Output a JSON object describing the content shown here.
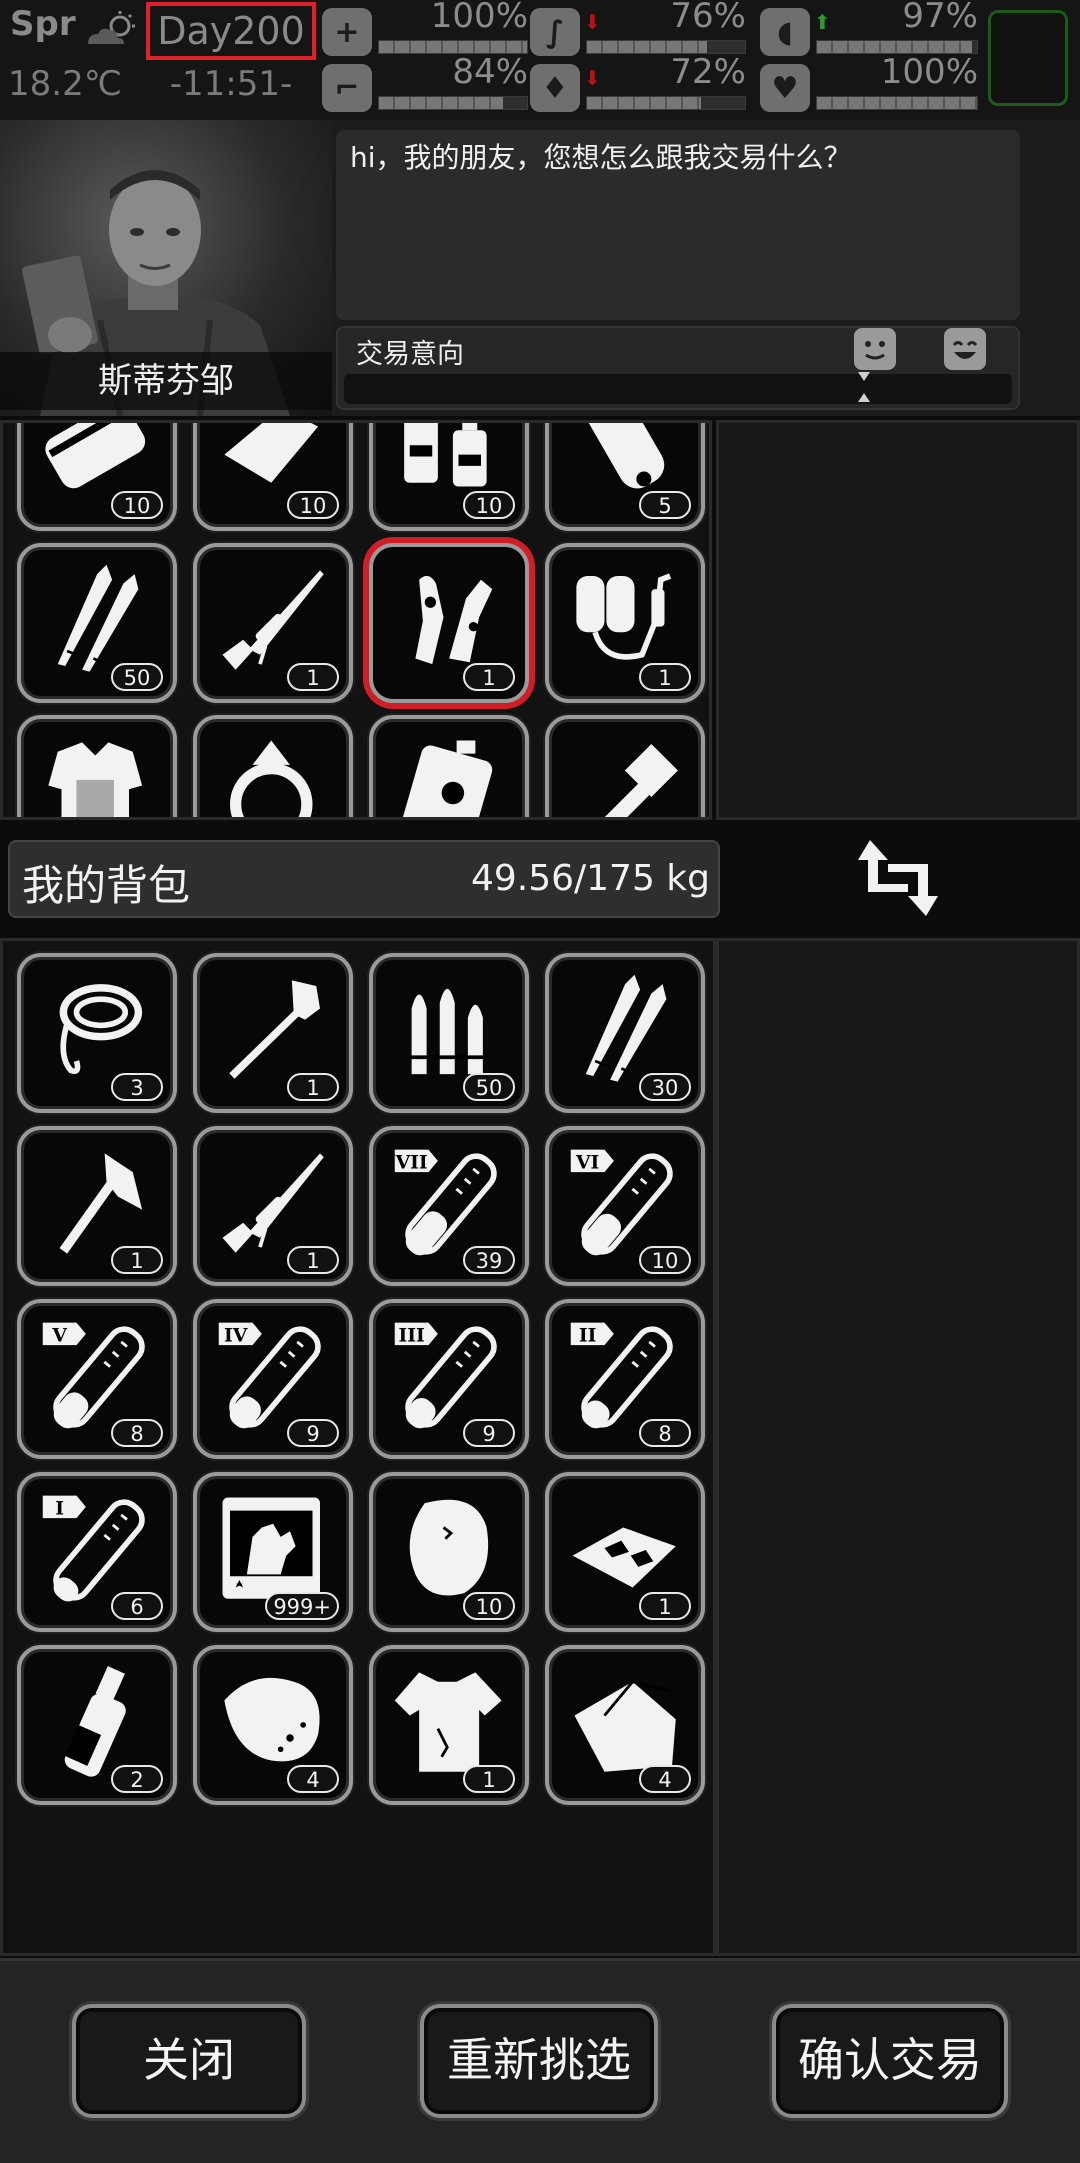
{
  "status": {
    "season": "Spr",
    "temperature": "18.2℃",
    "day": "Day200",
    "time": "-11:51-",
    "stats": [
      {
        "name": "health",
        "icon": "medkit-icon",
        "percent": "100%",
        "level": 1.0,
        "trend": ""
      },
      {
        "name": "hunger",
        "icon": "stomach-icon",
        "percent": "76%",
        "level": 0.76,
        "trend": "down"
      },
      {
        "name": "mood",
        "icon": "pill-icon",
        "percent": "97%",
        "level": 0.97,
        "trend": "up"
      },
      {
        "name": "stamina",
        "icon": "boot-icon",
        "percent": "84%",
        "level": 0.84,
        "trend": ""
      },
      {
        "name": "thirst",
        "icon": "water-drop-icon",
        "percent": "72%",
        "level": 0.72,
        "trend": "down"
      },
      {
        "name": "life",
        "icon": "heart-icon",
        "percent": "100%",
        "level": 1.0,
        "trend": ""
      }
    ]
  },
  "npc": {
    "name": "斯蒂芬邹",
    "dialog": "hi，我的朋友，您想怎么跟我交易什么？",
    "intent_label": "交易意向",
    "intent_level": 0.5
  },
  "trader_items": [
    {
      "icon": "canned-food-icon",
      "count": "10"
    },
    {
      "icon": "bread-icon",
      "count": "10"
    },
    {
      "icon": "spray-bottles-icon",
      "count": "10"
    },
    {
      "icon": "scroll-icon",
      "count": "5"
    },
    {
      "icon": "bullets-icon",
      "count": "50"
    },
    {
      "icon": "sniper-rifle-icon",
      "count": "1"
    },
    {
      "icon": "zombie-hand-icon",
      "count": "1",
      "selected": true
    },
    {
      "icon": "flamethrower-icon",
      "count": "1"
    },
    {
      "icon": "body-armor-icon",
      "count": ""
    },
    {
      "icon": "ring-icon",
      "count": ""
    },
    {
      "icon": "fuel-can-icon",
      "count": ""
    },
    {
      "icon": "gatling-gun-icon",
      "count": ""
    }
  ],
  "backpack": {
    "title": "我的背包",
    "weight": "49.56/175 kg",
    "items": [
      {
        "icon": "rope-icon",
        "count": "3"
      },
      {
        "icon": "shovel-icon",
        "count": "1"
      },
      {
        "icon": "ammo-rounds-icon",
        "count": "50"
      },
      {
        "icon": "bullets-icon",
        "count": "30"
      },
      {
        "icon": "axe-icon",
        "count": "1"
      },
      {
        "icon": "sniper-rifle-icon",
        "count": "1"
      },
      {
        "icon": "test-tube-icon",
        "tier": "VII",
        "fill": 0.45,
        "count": "39"
      },
      {
        "icon": "test-tube-icon",
        "tier": "VI",
        "fill": 0.42,
        "count": "10"
      },
      {
        "icon": "test-tube-icon",
        "tier": "V",
        "fill": 0.35,
        "count": "8"
      },
      {
        "icon": "test-tube-icon",
        "tier": "IV",
        "fill": 0.3,
        "count": "9"
      },
      {
        "icon": "test-tube-icon",
        "tier": "III",
        "fill": 0.28,
        "count": "9"
      },
      {
        "icon": "test-tube-icon",
        "tier": "II",
        "fill": 0.25,
        "count": "8"
      },
      {
        "icon": "test-tube-icon",
        "tier": "I",
        "fill": 0.2,
        "count": "6"
      },
      {
        "icon": "zombie-card-icon",
        "count": "999+"
      },
      {
        "icon": "meat-icon",
        "count": "10"
      },
      {
        "icon": "crackers-icon",
        "count": "1"
      },
      {
        "icon": "bottle-icon",
        "count": "2"
      },
      {
        "icon": "sack-icon",
        "count": "4"
      },
      {
        "icon": "torn-shirt-icon",
        "count": "1"
      },
      {
        "icon": "cloth-icon",
        "count": "4"
      }
    ]
  },
  "buttons": {
    "close": "关闭",
    "reselect": "重新挑选",
    "confirm": "确认交易"
  }
}
